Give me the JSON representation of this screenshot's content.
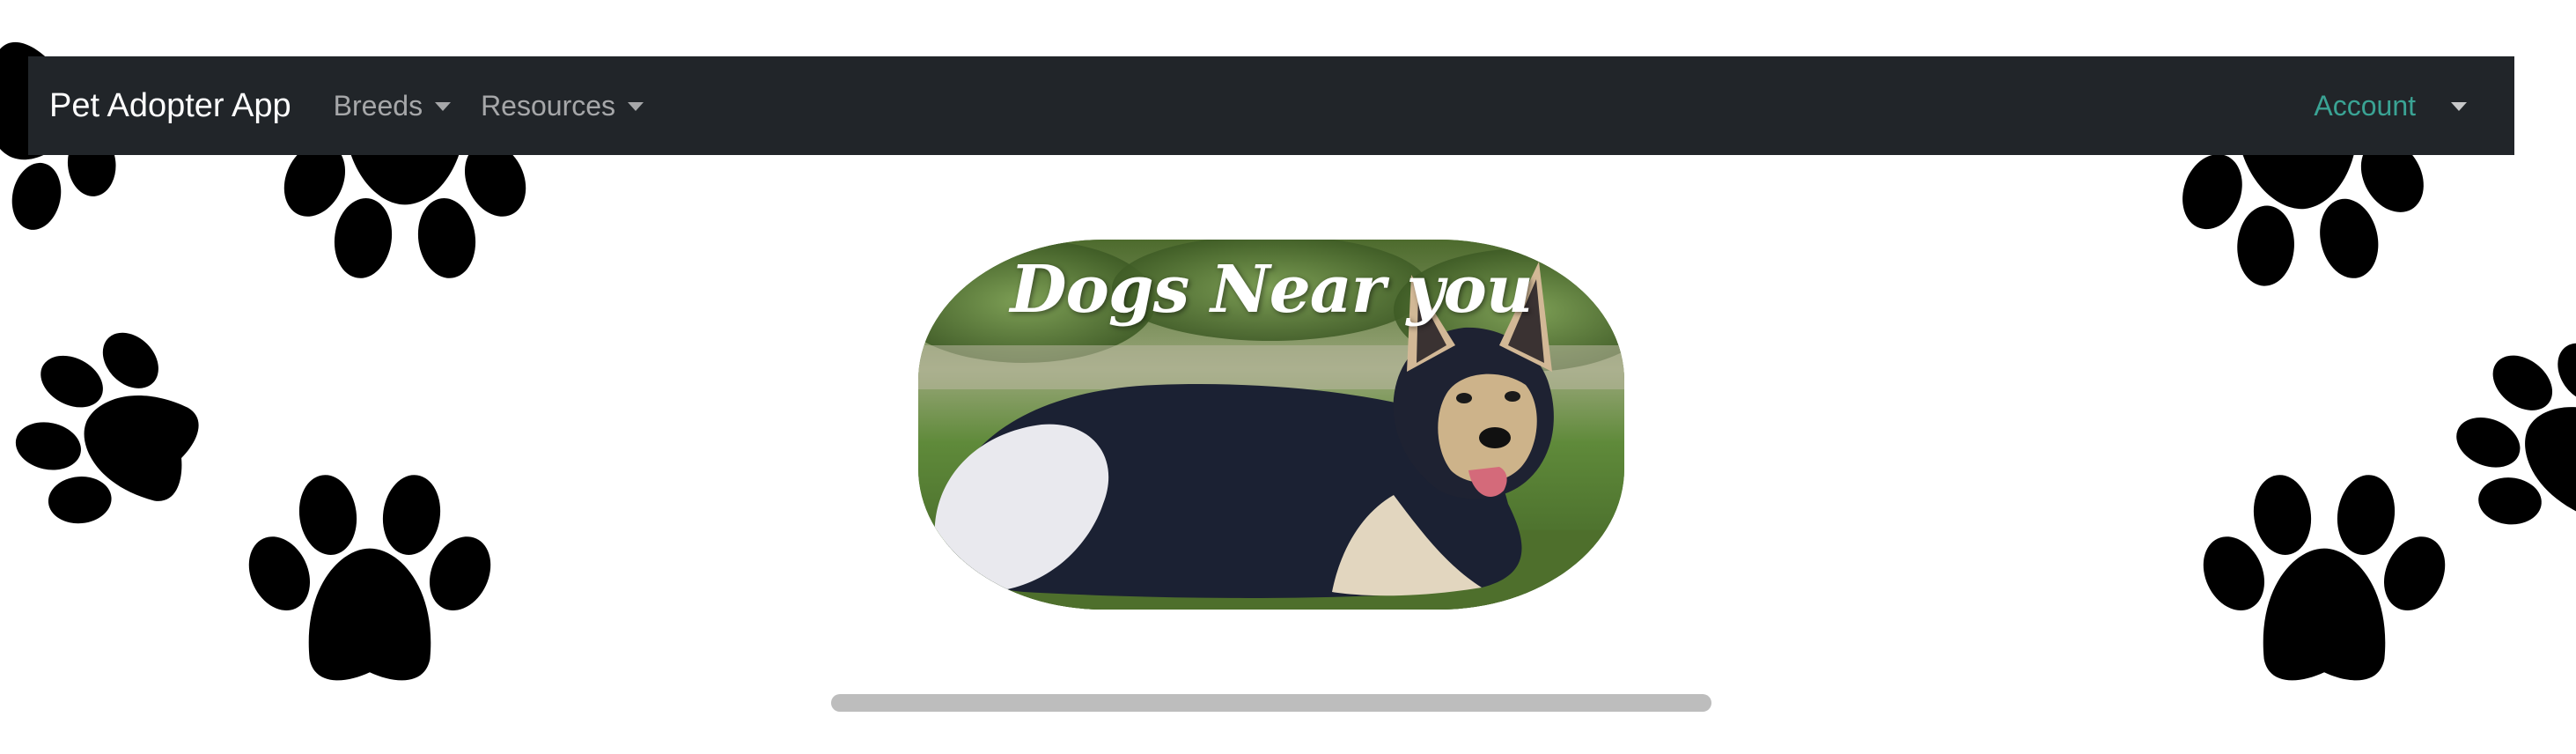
{
  "navbar": {
    "brand": "Pet Adopter App",
    "breeds_label": "Breeds",
    "resources_label": "Resources",
    "account_label": "Account"
  },
  "hero": {
    "title": "Dogs Near you"
  },
  "colors": {
    "navbar_bg": "#212529",
    "account_link": "#3aa394",
    "paw": "#000000"
  },
  "icons": {
    "paw": "paw-print-icon",
    "caret": "caret-down-icon"
  }
}
